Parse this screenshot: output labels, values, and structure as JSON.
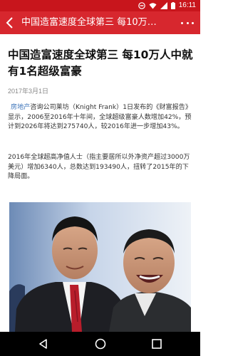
{
  "status_bar": {
    "time": "16:11"
  },
  "app_bar": {
    "title": "中国造富速度全球第三 每10万人..."
  },
  "article": {
    "headline": "中国造富速度全球第三 每10万人中就有1名超级富豪",
    "date": "2017年3月1日",
    "tag": "房地产",
    "para1_rest": "咨询公司莱坊（Knight Frank）1日发布的《财富报告》显示，2006至2016年十年间，全球超级富豪人数增加42%，预计到2026年将达到275740人，较2016年进一步增加43%。",
    "para2": "2016年全球超高净值人士（指主要居所以外净资产超过3000万美元）增加6340人，总数达到193490人，扭转了2015年的下降局面。"
  },
  "colors": {
    "status_bar": "#c8151c",
    "app_bar": "#d7272e",
    "tag_link": "#3b73b9"
  },
  "icons": {
    "back": "back-arrow-icon",
    "more": "more-icon",
    "nav_back": "nav-back-icon",
    "nav_home": "nav-home-icon",
    "nav_recents": "nav-recents-icon"
  }
}
